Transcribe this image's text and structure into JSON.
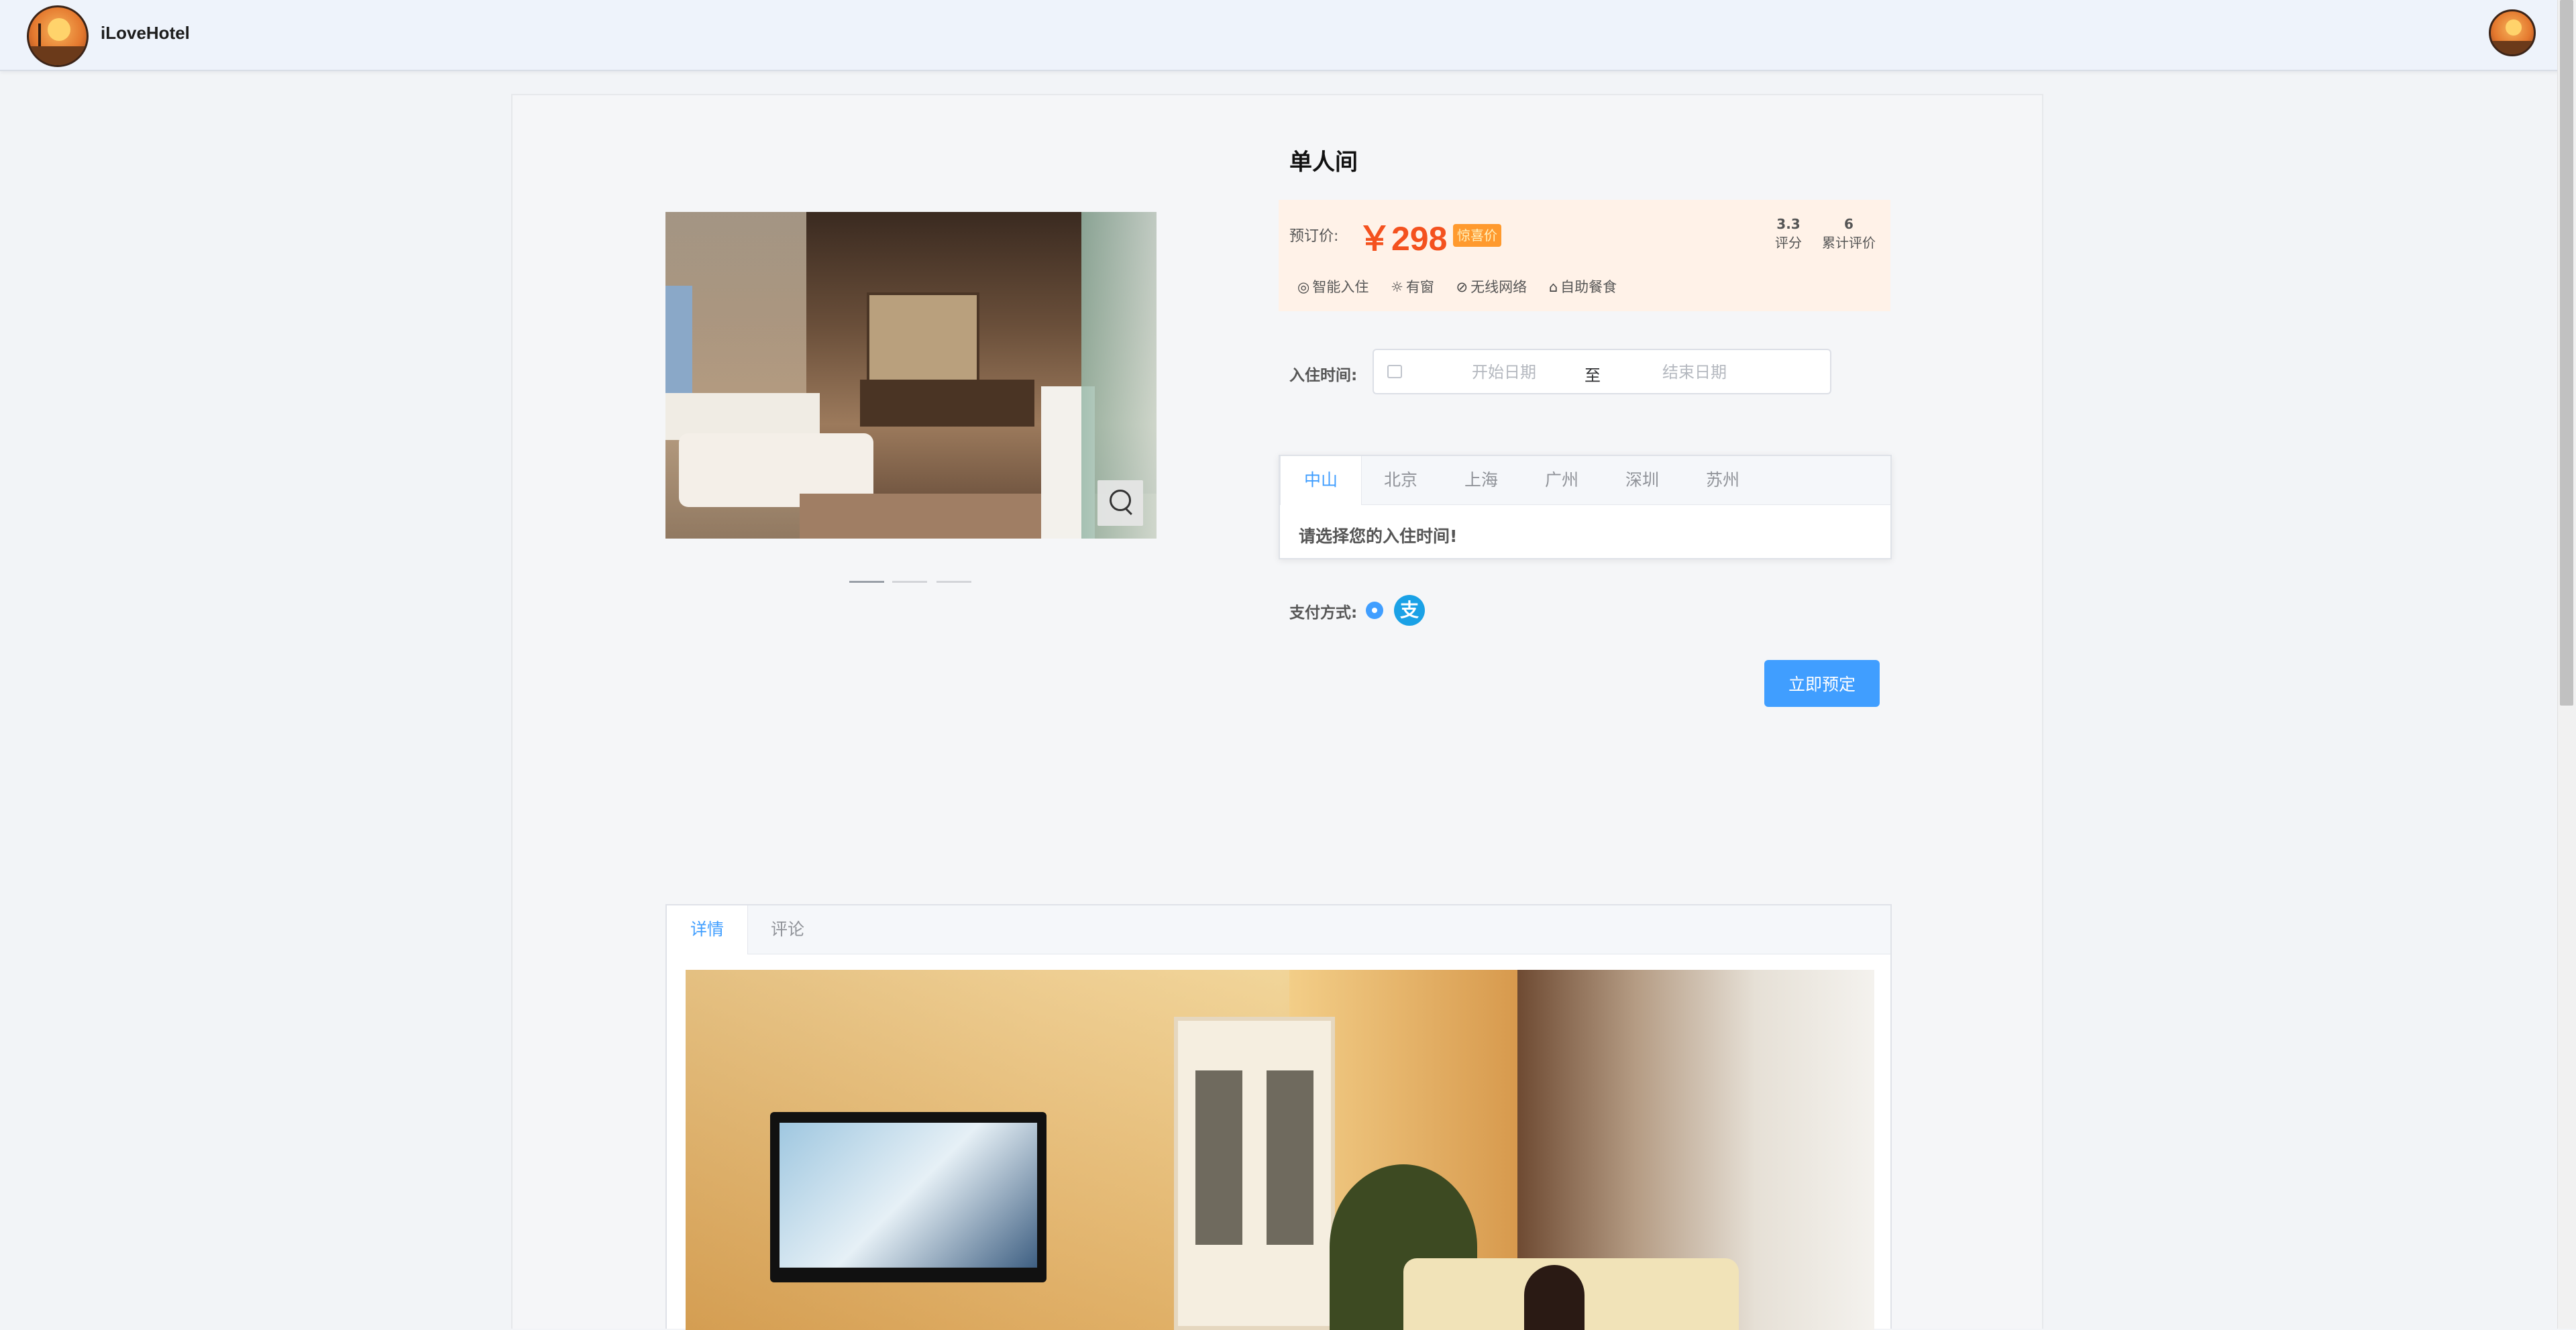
{
  "header": {
    "brand": "iLoveHotel"
  },
  "room": {
    "title": "单人间",
    "price_label": "预订价:",
    "price": "￥298",
    "price_badge": "惊喜价",
    "rating_value": "3.3",
    "rating_label": "评分",
    "review_count": "6",
    "review_label": "累计评价",
    "features": [
      {
        "icon": "smart-checkin-icon",
        "glyph": "◎",
        "label": "智能入住"
      },
      {
        "icon": "sun-icon",
        "glyph": "☼",
        "label": "有窗"
      },
      {
        "icon": "wifi-compass-icon",
        "glyph": "⊘",
        "label": "无线网络"
      },
      {
        "icon": "dining-cloche-icon",
        "glyph": "⌂",
        "label": "自助餐食"
      }
    ]
  },
  "carousel": {
    "slide_count": 3,
    "active_index": 0
  },
  "booking": {
    "date_label": "入住时间:",
    "start_placeholder": "开始日期",
    "separator": "至",
    "end_placeholder": "结束日期",
    "city_tabs": [
      "中山",
      "北京",
      "上海",
      "广州",
      "深圳",
      "苏州"
    ],
    "active_city": "中山",
    "city_message": "请选择您的入住时间!",
    "payment_label": "支付方式:",
    "payment_icon": "alipay-icon",
    "payment_glyph": "支",
    "book_button": "立即预定"
  },
  "detail": {
    "tabs": [
      "详情",
      "评论"
    ],
    "active_tab": "详情"
  },
  "colors": {
    "accent": "#409eff",
    "price": "#f4511e",
    "badge": "#ff9a2e",
    "price_bg": "#fff2e8"
  }
}
